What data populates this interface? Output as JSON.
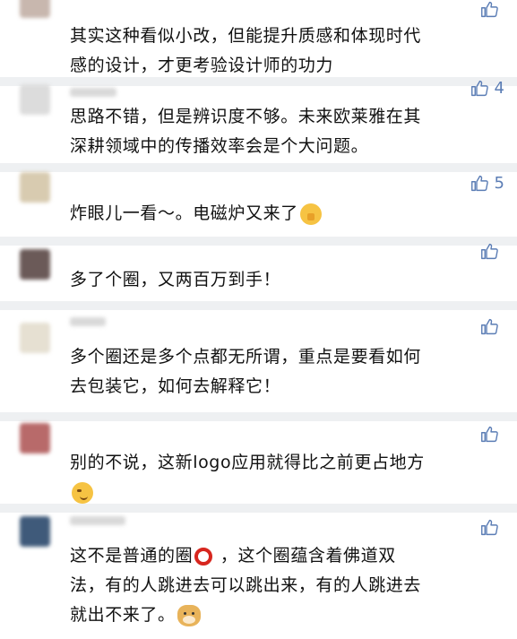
{
  "comments": [
    {
      "likes": "",
      "lines": [
        "其实这种看似小改，但能提升质感和体现时代",
        "感的设计，才更考验设计师的功力"
      ]
    },
    {
      "likes": "4",
      "lines": [
        "思路不错，但是辨识度不够。未来欧莱雅在其",
        "深耕领域中的传播效率会是个大问题。"
      ]
    },
    {
      "likes": "5",
      "lines": [
        "炸眼儿一看～。电磁炉又来了"
      ]
    },
    {
      "likes": "",
      "lines": [
        "多了个圈，又两百万到手！"
      ]
    },
    {
      "likes": "",
      "lines": [
        "多个圈还是多个点都无所谓，重点是要看如何",
        "去包装它，如何去解释它！"
      ]
    },
    {
      "likes": "",
      "lines": [
        "别的不说，这新logo应用就得比之前更占地方"
      ]
    },
    {
      "likes": "",
      "lines": [
        "这不是普通的圈",
        " ，这个圈蕴含着佛道双",
        "法，有的人跳进去可以跳出来，有的人跳进去",
        "就出不来了。"
      ]
    }
  ],
  "icons": {
    "like": "thumbs-up-icon"
  },
  "colors": {
    "like": "#5b7db5",
    "separator": "#eef0f2",
    "text": "#111111"
  }
}
